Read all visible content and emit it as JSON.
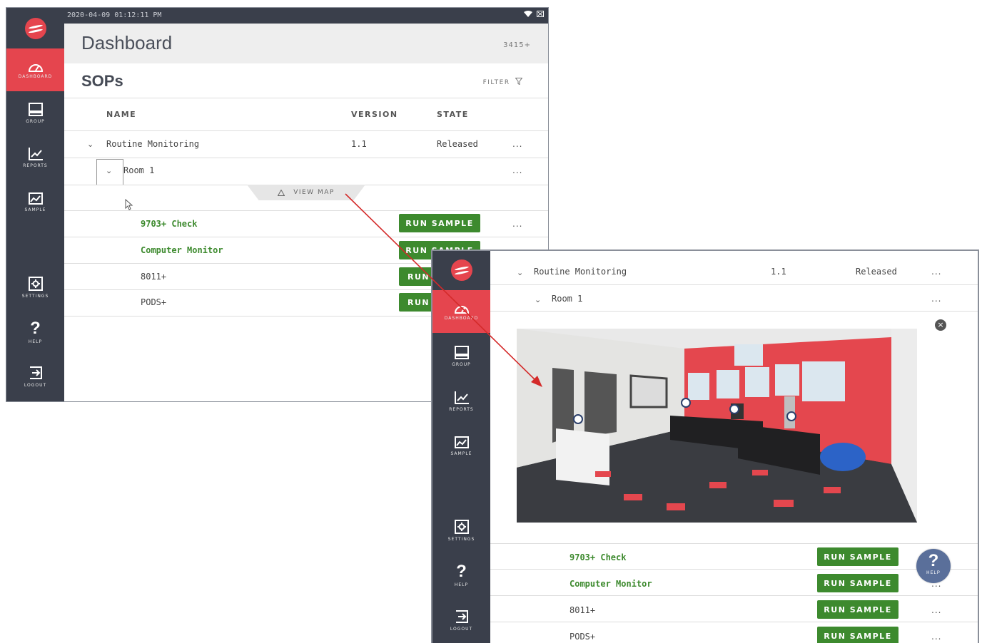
{
  "screen1": {
    "timestamp": "2020-04-09 01:12:11 PM",
    "page_title": "Dashboard",
    "device_id": "3415+",
    "section_title": "SOPs",
    "filter_label": "FILTER",
    "columns": {
      "name": "NAME",
      "version": "VERSION",
      "state": "STATE"
    },
    "group_row": {
      "name": "Routine Monitoring",
      "version": "1.1",
      "state": "Released",
      "menu": "..."
    },
    "room_row": {
      "name": "Room 1",
      "menu": "..."
    },
    "view_map_label": "VIEW MAP",
    "samples": [
      {
        "name": "9703+ Check",
        "button": "RUN SAMPLE",
        "menu": "..."
      },
      {
        "name": "Computer Monitor",
        "button": "RUN SAMPLE"
      },
      {
        "name": "8011+",
        "button": "RUN"
      },
      {
        "name": "PODS+",
        "button": "RUN"
      }
    ]
  },
  "screen2": {
    "group_row": {
      "name": "Routine Monitoring",
      "version": "1.1",
      "state": "Released",
      "menu": "..."
    },
    "room_row": {
      "name": "Room 1",
      "menu": "..."
    },
    "close_icon": "×",
    "samples": [
      {
        "name": "9703+ Check",
        "button": "RUN SAMPLE"
      },
      {
        "name": "Computer Monitor",
        "button": "RUN SAMPLE",
        "menu": "..."
      },
      {
        "name": "8011+",
        "button": "RUN SAMPLE",
        "menu": "..."
      },
      {
        "name": "PODS+",
        "button": "RUN SAMPLE",
        "menu": "..."
      }
    ],
    "help_bubble": {
      "symbol": "?",
      "label": "HELP"
    }
  },
  "sidebar": {
    "items": [
      {
        "label": "DASHBOARD",
        "icon": "gauge-icon"
      },
      {
        "label": "GROUP",
        "icon": "monitor-icon"
      },
      {
        "label": "REPORTS",
        "icon": "chart-line-icon"
      },
      {
        "label": "SAMPLE",
        "icon": "sample-image-icon"
      },
      {
        "label": "SETTINGS",
        "icon": "gear-icon"
      },
      {
        "label": "HELP",
        "symbol": "?",
        "icon": "question-icon"
      },
      {
        "label": "LOGOUT",
        "icon": "logout-icon"
      }
    ]
  },
  "colors": {
    "accent": "#e5454e",
    "sidebar": "#3a3f4b",
    "green": "#3d8a2e",
    "arrow": "#d42a2a"
  }
}
